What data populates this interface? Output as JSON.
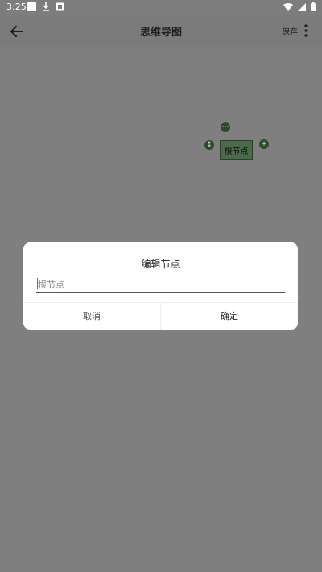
{
  "status_bar": {
    "time": "3:25",
    "icons": [
      "notification-square-icon",
      "download-icon",
      "app-icon",
      "wifi-icon",
      "signal-icon",
      "battery-icon"
    ]
  },
  "app_bar": {
    "title": "思维导图",
    "save_label": "保存"
  },
  "mind_map": {
    "root_node_label": "根节点",
    "controls": [
      "more-icon",
      "collapse-icon",
      "add-icon"
    ]
  },
  "dialog": {
    "title": "编辑节点",
    "input_value": "根节点",
    "cancel_label": "取消",
    "ok_label": "确定"
  },
  "colors": {
    "scrim": "#7f7f7f",
    "node_fill": "#4b6a4b",
    "control_fill": "#2d4a2d"
  }
}
